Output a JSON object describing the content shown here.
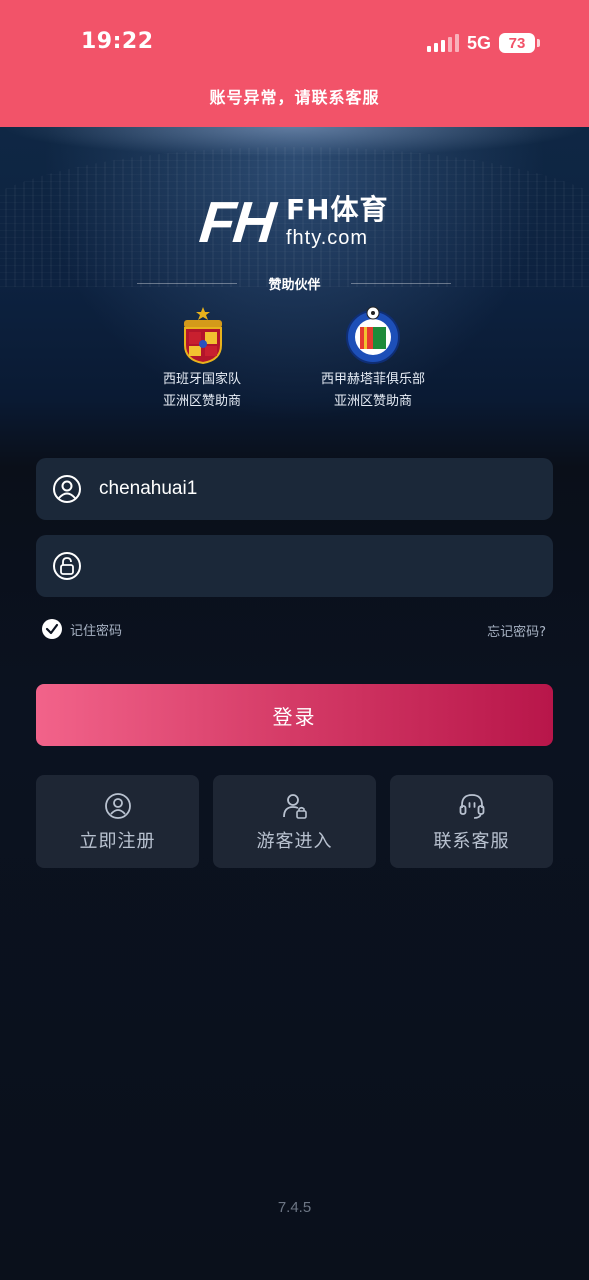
{
  "status_bar": {
    "time": "19:22",
    "network": "5G",
    "battery": "73"
  },
  "alert": {
    "text": "账号异常，请联系客服"
  },
  "brand": {
    "logo_mark": "FH",
    "name_cn": "FH体育",
    "domain": "fhty.com"
  },
  "sponsors": {
    "title": "赞助伙伴",
    "items": [
      {
        "line1": "西班牙国家队",
        "line2": "亚洲区赞助商",
        "icon": "spain-crest-icon"
      },
      {
        "line1": "西甲赫塔菲俱乐部",
        "line2": "亚洲区赞助商",
        "icon": "getafe-crest-icon"
      }
    ]
  },
  "login_form": {
    "username_value": "chenahuai1",
    "password_value": "",
    "remember_label": "记住密码",
    "forgot_label": "忘记密码?",
    "submit_label": "登录"
  },
  "actions": [
    {
      "label": "立即注册",
      "icon": "user-circle-icon"
    },
    {
      "label": "游客进入",
      "icon": "guest-user-icon"
    },
    {
      "label": "联系客服",
      "icon": "headset-icon"
    }
  ],
  "version": "7.4.5",
  "colors": {
    "banner": "#f25369",
    "login_gradient_start": "#f2638a",
    "login_gradient_end": "#b8164a",
    "field_bg": "#1b2839",
    "tile_bg": "#1e2634"
  }
}
